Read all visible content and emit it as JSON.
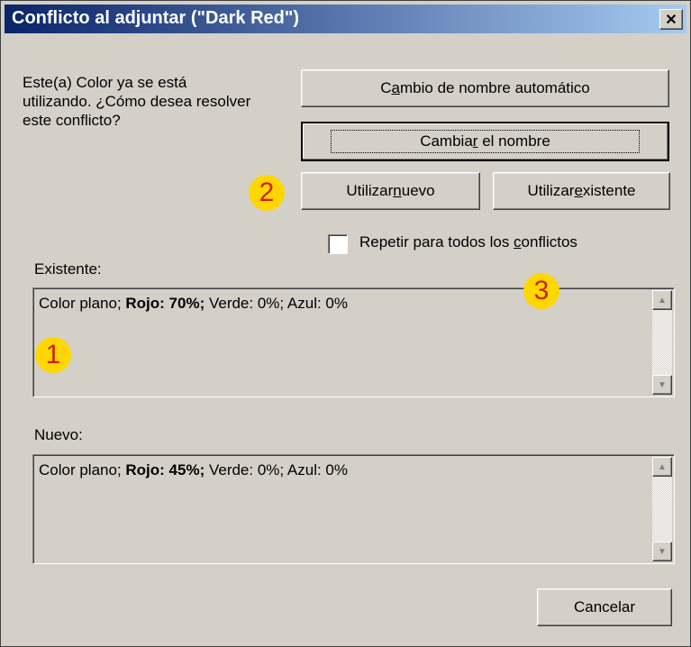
{
  "window": {
    "title": "Conflicto al adjuntar (\"Dark Red\")",
    "close_label": "✕"
  },
  "message": "Este(a) Color ya se está utilizando. ¿Cómo desea resolver este conflicto?",
  "buttons": {
    "auto_rename": {
      "before": "C",
      "accel": "a",
      "after": "mbio de nombre automático"
    },
    "rename": {
      "before": "Cambia",
      "accel": "r",
      "after": " el nombre"
    },
    "use_new": {
      "before": "Utilizar ",
      "accel": "n",
      "after": "uevo"
    },
    "use_existing": {
      "before": "Utilizar ",
      "accel": "e",
      "after": "xistente"
    },
    "cancel": "Cancelar"
  },
  "repeat_checkbox": {
    "before": "Repetir para todos los ",
    "accel": "c",
    "after": "onflictos",
    "checked": false
  },
  "existing": {
    "label": "Existente:",
    "text_prefix": "Color plano; ",
    "text_bold": "Rojo: 70%;",
    "text_suffix": " Verde: 0%; Azul: 0%"
  },
  "new": {
    "label": "Nuevo:",
    "text_prefix": "Color plano; ",
    "text_bold": "Rojo: 45%;",
    "text_suffix": " Verde: 0%; Azul: 0%"
  },
  "badges": [
    "1",
    "2",
    "3"
  ],
  "icons": {
    "scroll_up": "▲",
    "scroll_down": "▼"
  },
  "colors": {
    "title_start": "#0a246a",
    "title_end": "#a6caf0",
    "badge_bg": "#ffd700",
    "badge_text": "#cc2200"
  }
}
